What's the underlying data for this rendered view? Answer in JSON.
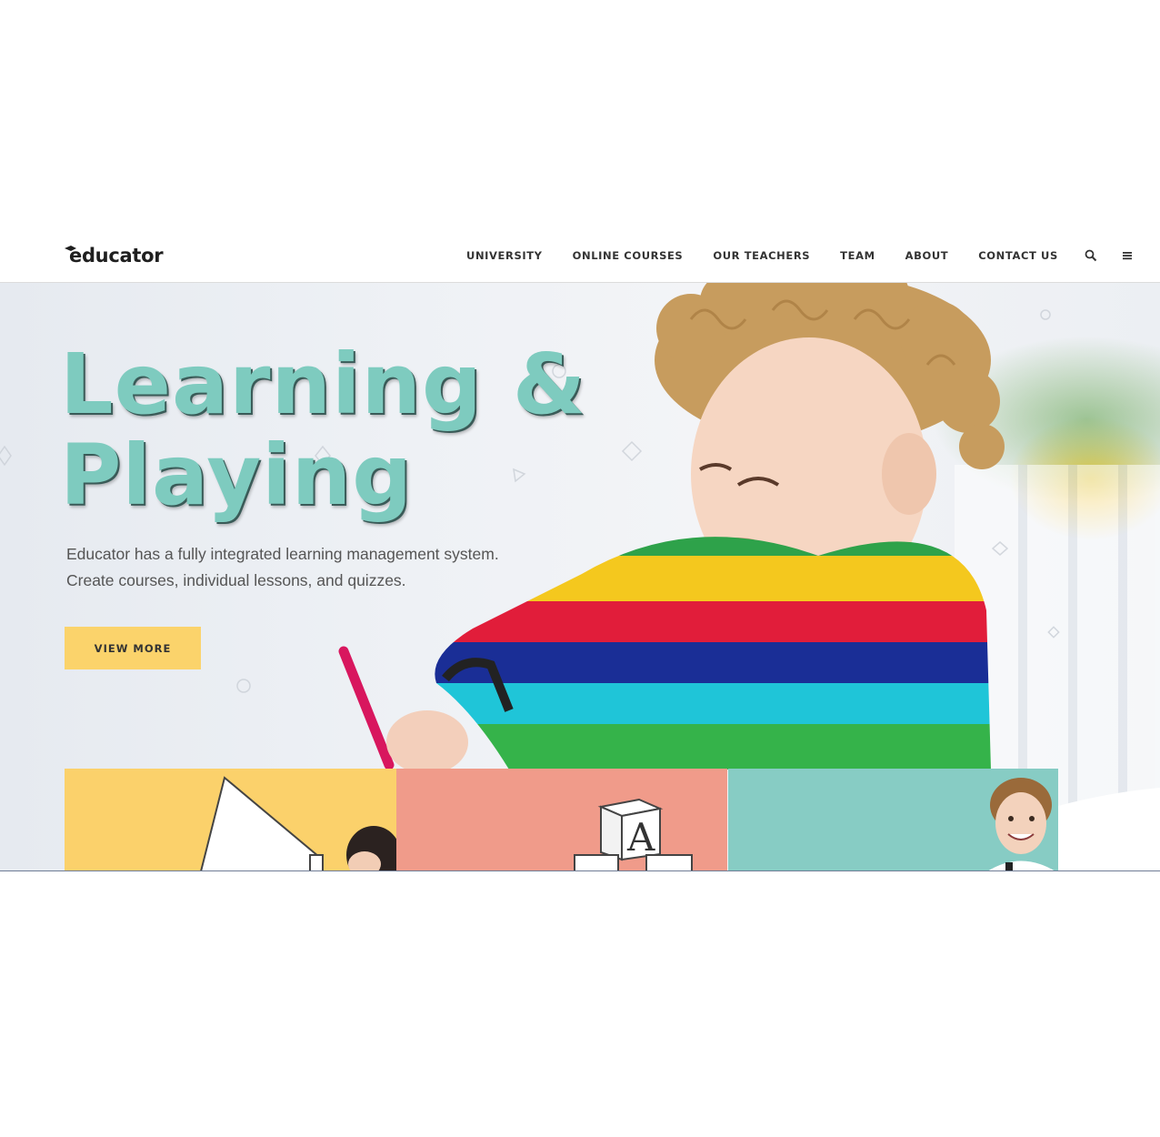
{
  "brand": {
    "logo_text": "educator"
  },
  "nav": {
    "items": [
      {
        "label": "UNIVERSITY"
      },
      {
        "label": "ONLINE COURSES"
      },
      {
        "label": "OUR TEACHERS"
      },
      {
        "label": "TEAM"
      },
      {
        "label": "ABOUT"
      },
      {
        "label": "CONTACT US"
      }
    ],
    "icons": [
      "search-icon",
      "menu-icon"
    ]
  },
  "hero": {
    "title_line1": "Learning &",
    "title_line2": "Playing",
    "desc_line1": "Educator has a fully integrated learning management system.",
    "desc_line2": "Create courses, individual lessons, and quizzes.",
    "cta_label": "VIEW MORE"
  },
  "cards": [
    {
      "color": "#fbd16b",
      "image": "megaphone-girl"
    },
    {
      "color": "#f09b8a",
      "image": "letter-blocks"
    },
    {
      "color": "#87ccc4",
      "image": "smiling-boy"
    }
  ],
  "colors": {
    "accent_teal": "#7ecbbf",
    "button_yellow": "#fbd36b",
    "card_pink": "#f09b8a",
    "card_teal": "#87ccc4"
  }
}
